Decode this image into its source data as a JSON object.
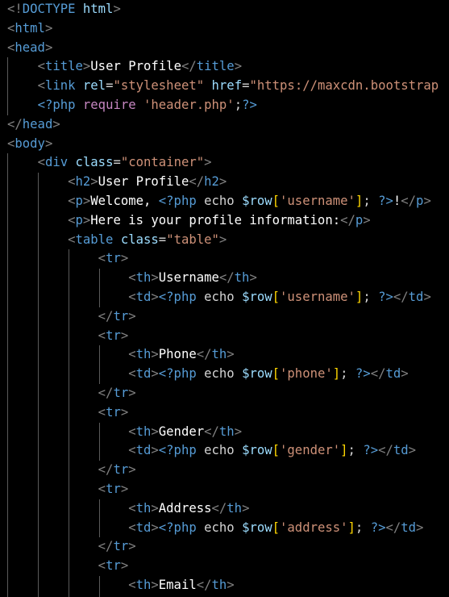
{
  "colors": {
    "background": "#000000",
    "punctuation": "#808080",
    "tag": "#569cd6",
    "attribute": "#9cdcfe",
    "string": "#ce9178",
    "text": "#ffffff",
    "php_keyword": "#c586c0",
    "bracket": "#ffd700",
    "indent_guide": "#5a5a5a"
  },
  "code_lines": [
    [
      [
        "punc",
        "<!"
      ],
      [
        "tag",
        "DOCTYPE"
      ],
      [
        "plain",
        " "
      ],
      [
        "attr",
        "html"
      ],
      [
        "punc",
        ">"
      ]
    ],
    [
      [
        "punc",
        "<"
      ],
      [
        "tag",
        "html"
      ],
      [
        "punc",
        ">"
      ]
    ],
    [
      [
        "punc",
        "<"
      ],
      [
        "tag",
        "head"
      ],
      [
        "punc",
        ">"
      ]
    ],
    [
      [
        "plain",
        "    "
      ],
      [
        "punc",
        "<"
      ],
      [
        "tag",
        "title"
      ],
      [
        "punc",
        ">"
      ],
      [
        "txt",
        "User Profile"
      ],
      [
        "punc",
        "</"
      ],
      [
        "tag",
        "title"
      ],
      [
        "punc",
        ">"
      ]
    ],
    [
      [
        "plain",
        "    "
      ],
      [
        "punc",
        "<"
      ],
      [
        "tag",
        "link"
      ],
      [
        "plain",
        " "
      ],
      [
        "attr",
        "rel"
      ],
      [
        "plain",
        "="
      ],
      [
        "str",
        "\"stylesheet\""
      ],
      [
        "plain",
        " "
      ],
      [
        "attr",
        "href"
      ],
      [
        "plain",
        "="
      ],
      [
        "str",
        "\"https://maxcdn.bootstrap"
      ]
    ],
    [
      [
        "plain",
        "    "
      ],
      [
        "php",
        "<?php"
      ],
      [
        "plain",
        " "
      ],
      [
        "fn",
        "require"
      ],
      [
        "plain",
        " "
      ],
      [
        "str",
        "'header.php'"
      ],
      [
        "plain",
        ";"
      ],
      [
        "php",
        "?>"
      ]
    ],
    [
      [
        "punc",
        "</"
      ],
      [
        "tag",
        "head"
      ],
      [
        "punc",
        ">"
      ]
    ],
    [
      [
        "punc",
        "<"
      ],
      [
        "tag",
        "body"
      ],
      [
        "punc",
        ">"
      ]
    ],
    [
      [
        "plain",
        "    "
      ],
      [
        "punc",
        "<"
      ],
      [
        "tag",
        "div"
      ],
      [
        "plain",
        " "
      ],
      [
        "attr",
        "class"
      ],
      [
        "plain",
        "="
      ],
      [
        "str",
        "\"container\""
      ],
      [
        "punc",
        ">"
      ]
    ],
    [
      [
        "plain",
        "        "
      ],
      [
        "punc",
        "<"
      ],
      [
        "tag",
        "h2"
      ],
      [
        "punc",
        ">"
      ],
      [
        "txt",
        "User Profile"
      ],
      [
        "punc",
        "</"
      ],
      [
        "tag",
        "h2"
      ],
      [
        "punc",
        ">"
      ]
    ],
    [
      [
        "plain",
        "        "
      ],
      [
        "punc",
        "<"
      ],
      [
        "tag",
        "p"
      ],
      [
        "punc",
        ">"
      ],
      [
        "txt",
        "Welcome, "
      ],
      [
        "php",
        "<?php"
      ],
      [
        "plain",
        " "
      ],
      [
        "plain",
        "echo"
      ],
      [
        "plain",
        " "
      ],
      [
        "var",
        "$row"
      ],
      [
        "brk",
        "["
      ],
      [
        "str",
        "'username'"
      ],
      [
        "brk",
        "]"
      ],
      [
        "plain",
        "; "
      ],
      [
        "php",
        "?>"
      ],
      [
        "txt",
        "!"
      ],
      [
        "punc",
        "</"
      ],
      [
        "tag",
        "p"
      ],
      [
        "punc",
        ">"
      ]
    ],
    [
      [
        "plain",
        "        "
      ],
      [
        "punc",
        "<"
      ],
      [
        "tag",
        "p"
      ],
      [
        "punc",
        ">"
      ],
      [
        "txt",
        "Here is your profile information:"
      ],
      [
        "punc",
        "</"
      ],
      [
        "tag",
        "p"
      ],
      [
        "punc",
        ">"
      ]
    ],
    [
      [
        "plain",
        "        "
      ],
      [
        "punc",
        "<"
      ],
      [
        "tag",
        "table"
      ],
      [
        "plain",
        " "
      ],
      [
        "attr",
        "class"
      ],
      [
        "plain",
        "="
      ],
      [
        "str",
        "\"table\""
      ],
      [
        "punc",
        ">"
      ]
    ],
    [
      [
        "plain",
        "            "
      ],
      [
        "punc",
        "<"
      ],
      [
        "tag",
        "tr"
      ],
      [
        "punc",
        ">"
      ]
    ],
    [
      [
        "plain",
        "                "
      ],
      [
        "punc",
        "<"
      ],
      [
        "tag",
        "th"
      ],
      [
        "punc",
        ">"
      ],
      [
        "txt",
        "Username"
      ],
      [
        "punc",
        "</"
      ],
      [
        "tag",
        "th"
      ],
      [
        "punc",
        ">"
      ]
    ],
    [
      [
        "plain",
        "                "
      ],
      [
        "punc",
        "<"
      ],
      [
        "tag",
        "td"
      ],
      [
        "punc",
        ">"
      ],
      [
        "php",
        "<?php"
      ],
      [
        "plain",
        " echo "
      ],
      [
        "var",
        "$row"
      ],
      [
        "brk",
        "["
      ],
      [
        "str",
        "'username'"
      ],
      [
        "brk",
        "]"
      ],
      [
        "plain",
        "; "
      ],
      [
        "php",
        "?>"
      ],
      [
        "punc",
        "</"
      ],
      [
        "tag",
        "td"
      ],
      [
        "punc",
        ">"
      ]
    ],
    [
      [
        "plain",
        "            "
      ],
      [
        "punc",
        "</"
      ],
      [
        "tag",
        "tr"
      ],
      [
        "punc",
        ">"
      ]
    ],
    [
      [
        "plain",
        "            "
      ],
      [
        "punc",
        "<"
      ],
      [
        "tag",
        "tr"
      ],
      [
        "punc",
        ">"
      ]
    ],
    [
      [
        "plain",
        "                "
      ],
      [
        "punc",
        "<"
      ],
      [
        "tag",
        "th"
      ],
      [
        "punc",
        ">"
      ],
      [
        "txt",
        "Phone"
      ],
      [
        "punc",
        "</"
      ],
      [
        "tag",
        "th"
      ],
      [
        "punc",
        ">"
      ]
    ],
    [
      [
        "plain",
        "                "
      ],
      [
        "punc",
        "<"
      ],
      [
        "tag",
        "td"
      ],
      [
        "punc",
        ">"
      ],
      [
        "php",
        "<?php"
      ],
      [
        "plain",
        " echo "
      ],
      [
        "var",
        "$row"
      ],
      [
        "brk",
        "["
      ],
      [
        "str",
        "'phone'"
      ],
      [
        "brk",
        "]"
      ],
      [
        "plain",
        "; "
      ],
      [
        "php",
        "?>"
      ],
      [
        "punc",
        "</"
      ],
      [
        "tag",
        "td"
      ],
      [
        "punc",
        ">"
      ]
    ],
    [
      [
        "plain",
        "            "
      ],
      [
        "punc",
        "</"
      ],
      [
        "tag",
        "tr"
      ],
      [
        "punc",
        ">"
      ]
    ],
    [
      [
        "plain",
        "            "
      ],
      [
        "punc",
        "<"
      ],
      [
        "tag",
        "tr"
      ],
      [
        "punc",
        ">"
      ]
    ],
    [
      [
        "plain",
        "                "
      ],
      [
        "punc",
        "<"
      ],
      [
        "tag",
        "th"
      ],
      [
        "punc",
        ">"
      ],
      [
        "txt",
        "Gender"
      ],
      [
        "punc",
        "</"
      ],
      [
        "tag",
        "th"
      ],
      [
        "punc",
        ">"
      ]
    ],
    [
      [
        "plain",
        "                "
      ],
      [
        "punc",
        "<"
      ],
      [
        "tag",
        "td"
      ],
      [
        "punc",
        ">"
      ],
      [
        "php",
        "<?php"
      ],
      [
        "plain",
        " echo "
      ],
      [
        "var",
        "$row"
      ],
      [
        "brk",
        "["
      ],
      [
        "str",
        "'gender'"
      ],
      [
        "brk",
        "]"
      ],
      [
        "plain",
        "; "
      ],
      [
        "php",
        "?>"
      ],
      [
        "punc",
        "</"
      ],
      [
        "tag",
        "td"
      ],
      [
        "punc",
        ">"
      ]
    ],
    [
      [
        "plain",
        "            "
      ],
      [
        "punc",
        "</"
      ],
      [
        "tag",
        "tr"
      ],
      [
        "punc",
        ">"
      ]
    ],
    [
      [
        "plain",
        "            "
      ],
      [
        "punc",
        "<"
      ],
      [
        "tag",
        "tr"
      ],
      [
        "punc",
        ">"
      ]
    ],
    [
      [
        "plain",
        "                "
      ],
      [
        "punc",
        "<"
      ],
      [
        "tag",
        "th"
      ],
      [
        "punc",
        ">"
      ],
      [
        "txt",
        "Address"
      ],
      [
        "punc",
        "</"
      ],
      [
        "tag",
        "th"
      ],
      [
        "punc",
        ">"
      ]
    ],
    [
      [
        "plain",
        "                "
      ],
      [
        "punc",
        "<"
      ],
      [
        "tag",
        "td"
      ],
      [
        "punc",
        ">"
      ],
      [
        "php",
        "<?php"
      ],
      [
        "plain",
        " echo "
      ],
      [
        "var",
        "$row"
      ],
      [
        "brk",
        "["
      ],
      [
        "str",
        "'address'"
      ],
      [
        "brk",
        "]"
      ],
      [
        "plain",
        "; "
      ],
      [
        "php",
        "?>"
      ],
      [
        "punc",
        "</"
      ],
      [
        "tag",
        "td"
      ],
      [
        "punc",
        ">"
      ]
    ],
    [
      [
        "plain",
        "            "
      ],
      [
        "punc",
        "</"
      ],
      [
        "tag",
        "tr"
      ],
      [
        "punc",
        ">"
      ]
    ],
    [
      [
        "plain",
        "            "
      ],
      [
        "punc",
        "<"
      ],
      [
        "tag",
        "tr"
      ],
      [
        "punc",
        ">"
      ]
    ],
    [
      [
        "plain",
        "                "
      ],
      [
        "punc",
        "<"
      ],
      [
        "tag",
        "th"
      ],
      [
        "punc",
        ">"
      ],
      [
        "txt",
        "Email"
      ],
      [
        "punc",
        "</"
      ],
      [
        "tag",
        "th"
      ],
      [
        "punc",
        ">"
      ]
    ]
  ]
}
